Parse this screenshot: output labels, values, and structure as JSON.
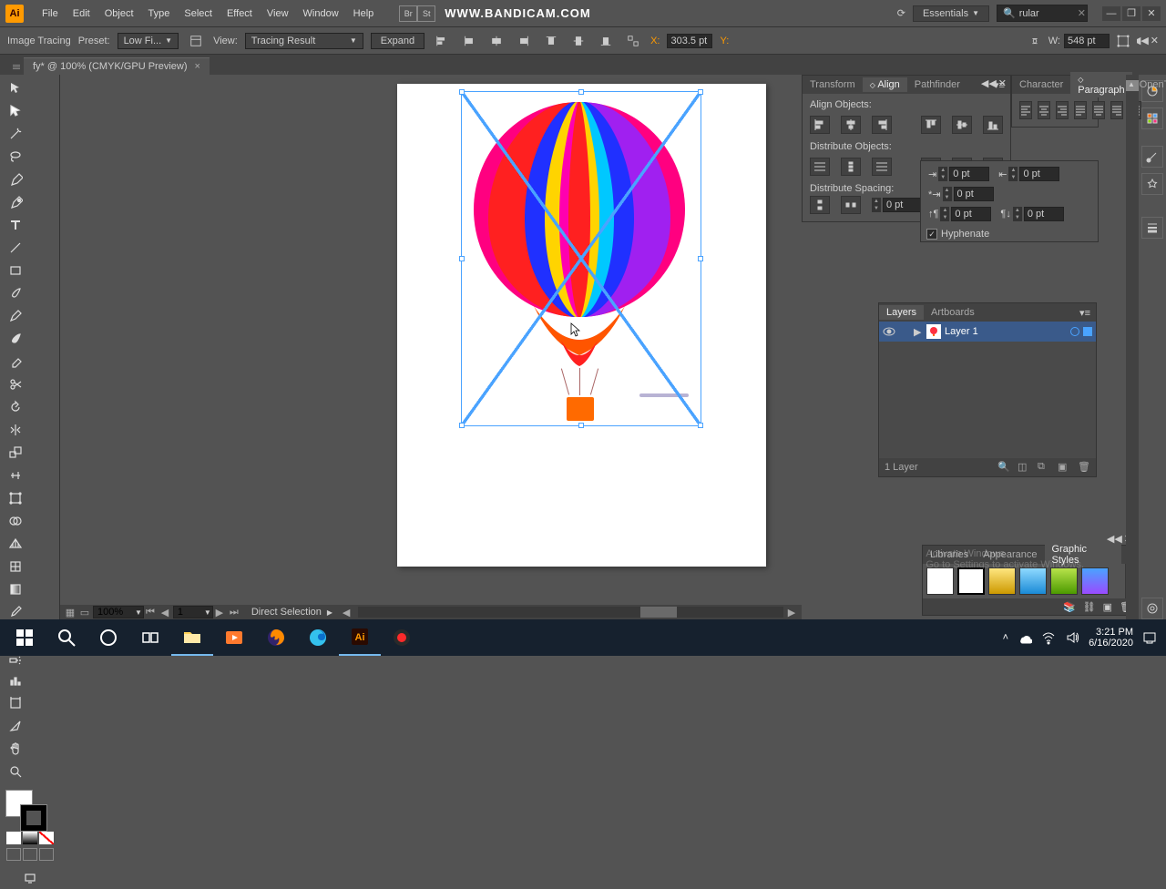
{
  "app": {
    "logo": "Ai",
    "watermark": "WWW.BANDICAM.COM"
  },
  "menu": [
    "File",
    "Edit",
    "Object",
    "Type",
    "Select",
    "Effect",
    "View",
    "Window",
    "Help"
  ],
  "menubar_right": {
    "workspace": "Essentials",
    "search_value": "rular",
    "search_icon": "🔍"
  },
  "ctrlbar": {
    "image_tracing": "Image Tracing",
    "preset_label": "Preset:",
    "preset_value": "Low Fi...",
    "view_label": "View:",
    "view_value": "Tracing Result",
    "expand": "Expand",
    "x_label": "X:",
    "x_value": "303.5 pt",
    "y_label": "Y:",
    "w_label": "W:",
    "w_value": "548 pt"
  },
  "doctab": {
    "title": "fy* @ 100% (CMYK/GPU Preview)",
    "close": "×"
  },
  "status": {
    "zoom": "100%",
    "artboard_num": "1",
    "tool": "Direct Selection"
  },
  "panels": {
    "align": {
      "tabs": [
        "Transform",
        "Align",
        "Pathfinder"
      ],
      "active": 1,
      "sec1": "Align Objects:",
      "sec2": "Distribute Objects:",
      "sec3": "Distribute Spacing:",
      "sec3b": "Align",
      "spacing_val": "0 pt"
    },
    "char": {
      "tabs": [
        "Character",
        "Paragraph",
        "OpenType"
      ],
      "active": 1
    },
    "paragraph": {
      "li": "0 pt",
      "ri": "0 pt",
      "fi": "0 pt",
      "sb": "0 pt",
      "sa": "0 pt",
      "hyphenate": "Hyphenate"
    },
    "layers": {
      "tabs": [
        "Layers",
        "Artboards"
      ],
      "active": 0,
      "items": [
        {
          "name": "Layer 1"
        }
      ],
      "footer": "1 Layer"
    },
    "styles": {
      "tabs": [
        "Libraries",
        "Appearance",
        "Graphic Styles"
      ],
      "active": 2
    }
  },
  "taskbar": {
    "time": "3:21 PM",
    "date": "6/16/2020"
  },
  "activate": {
    "title": "Activate Windows",
    "sub": "Go to Settings to activate Windows."
  }
}
